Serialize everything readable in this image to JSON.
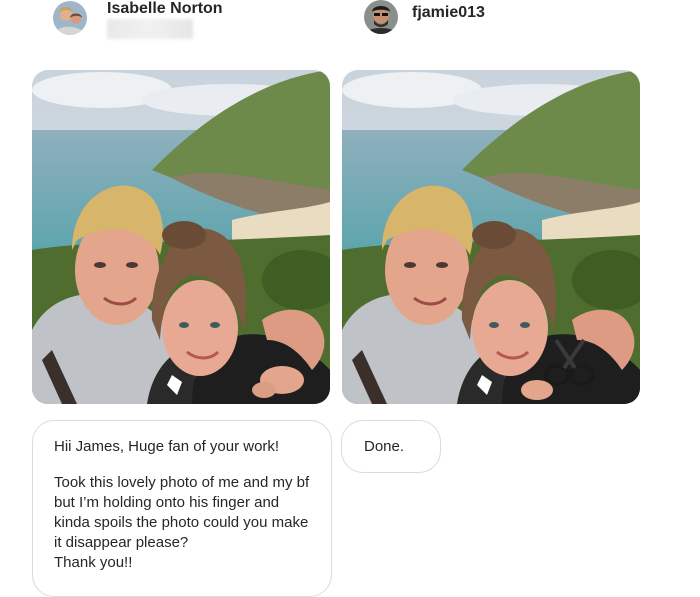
{
  "left_message": {
    "sender": "Isabelle Norton",
    "sender_avatar": "avatar-isabelle",
    "photo": "selfie-couple-beach-holding-finger",
    "text_line1": "Hii James, Huge fan of your work!",
    "text_line2": "Took this lovely photo of me and my bf but I’m holding onto his finger and kinda spoils the photo could you make it disappear please?",
    "text_line3": "Thank you!!"
  },
  "right_message": {
    "sender": "fjamie013",
    "sender_avatar": "avatar-fjamie",
    "photo": "selfie-couple-beach-edited-scissors",
    "reply": "Done."
  },
  "colors": {
    "text": "#262626",
    "bubble_border": "#dbdbdb"
  }
}
